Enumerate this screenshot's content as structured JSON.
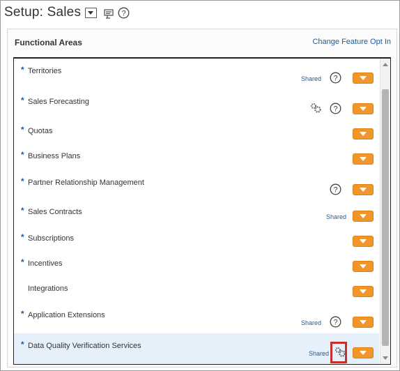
{
  "header": {
    "title": "Setup: Sales",
    "icons": [
      "dropdown-arrow-icon",
      "page-settings-icon",
      "help-icon"
    ]
  },
  "panel": {
    "title": "Functional Areas",
    "link": "Change Feature Opt In"
  },
  "rows": [
    {
      "label": "Territories",
      "required": true,
      "shared": true,
      "gear": false,
      "help": true
    },
    {
      "label": "Sales Forecasting",
      "required": true,
      "shared": false,
      "gear": true,
      "help": true
    },
    {
      "label": "Quotas",
      "required": true,
      "shared": false,
      "gear": false,
      "help": false
    },
    {
      "label": "Business Plans",
      "required": true,
      "shared": false,
      "gear": false,
      "help": false
    },
    {
      "label": "Partner Relationship Management",
      "required": true,
      "shared": false,
      "gear": false,
      "help": true
    },
    {
      "label": "Sales Contracts",
      "required": true,
      "shared": true,
      "gear": false,
      "help": false
    },
    {
      "label": "Subscriptions",
      "required": true,
      "shared": false,
      "gear": false,
      "help": false
    },
    {
      "label": "Incentives",
      "required": true,
      "shared": false,
      "gear": false,
      "help": false
    },
    {
      "label": "Integrations",
      "required": false,
      "shared": false,
      "gear": false,
      "help": false
    },
    {
      "label": "Application Extensions",
      "required": true,
      "shared": true,
      "gear": false,
      "help": true
    },
    {
      "label": "Data Quality Verification Services",
      "required": true,
      "shared": true,
      "gear": true,
      "help": false,
      "selected": true,
      "highlighted": true
    }
  ],
  "labels": {
    "shared": "Shared",
    "required_mark": "*"
  },
  "colors": {
    "action_button": "#f0962b",
    "link": "#1f5b9a",
    "highlight": "#c3302d",
    "selected_row": "#e6f0fb"
  }
}
